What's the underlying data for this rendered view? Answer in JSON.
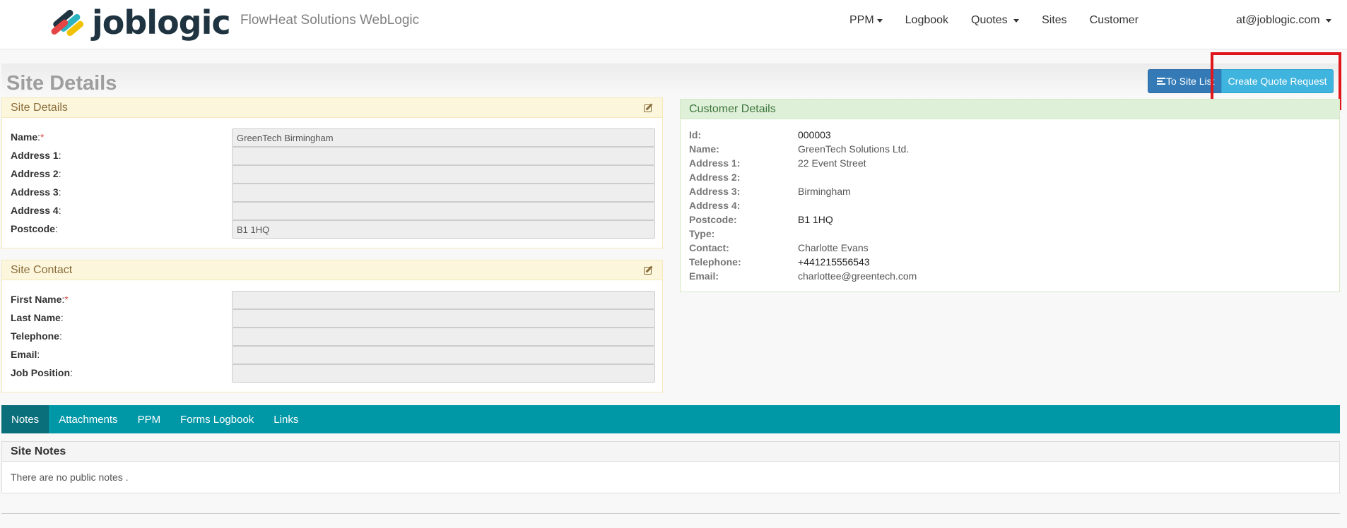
{
  "brand": {
    "logo_text": "joblogic",
    "company": "FlowHeat Solutions WebLogic"
  },
  "nav": {
    "ppm": "PPM",
    "logbook": "Logbook",
    "quotes": "Quotes",
    "sites": "Sites",
    "customer": "Customer",
    "user": "at@joblogic.com"
  },
  "page": {
    "title": "Site Details",
    "to_site_list": "To Site List",
    "create_quote": "Create Quote Request"
  },
  "site_details": {
    "heading": "Site Details",
    "fields": [
      {
        "label": "Name",
        "required": true,
        "value": "GreenTech Birmingham"
      },
      {
        "label": "Address 1",
        "required": false,
        "value": ""
      },
      {
        "label": "Address 2",
        "required": false,
        "value": ""
      },
      {
        "label": "Address 3",
        "required": false,
        "value": ""
      },
      {
        "label": "Address 4",
        "required": false,
        "value": ""
      },
      {
        "label": "Postcode",
        "required": false,
        "value": "B1 1HQ"
      }
    ]
  },
  "site_contact": {
    "heading": "Site Contact",
    "fields": [
      {
        "label": "First Name",
        "required": true,
        "value": ""
      },
      {
        "label": "Last Name",
        "required": false,
        "value": ""
      },
      {
        "label": "Telephone",
        "required": false,
        "value": ""
      },
      {
        "label": "Email",
        "required": false,
        "value": ""
      },
      {
        "label": "Job Position",
        "required": false,
        "value": ""
      }
    ]
  },
  "customer_details": {
    "heading": "Customer Details",
    "rows": [
      {
        "label": "Id:",
        "value": "000003"
      },
      {
        "label": "Name:",
        "value": "GreenTech Solutions Ltd."
      },
      {
        "label": "Address 1:",
        "value": "22 Event Street"
      },
      {
        "label": "Address 2:",
        "value": ""
      },
      {
        "label": "Address 3:",
        "value": "Birmingham"
      },
      {
        "label": "Address 4:",
        "value": ""
      },
      {
        "label": "Postcode:",
        "value": "B1 1HQ"
      },
      {
        "label": "Type:",
        "value": ""
      },
      {
        "label": "Contact:",
        "value": "Charlotte Evans"
      },
      {
        "label": "Telephone:",
        "value": "+441215556543"
      },
      {
        "label": "Email:",
        "value": "charlottee@greentech.com"
      }
    ]
  },
  "tabs": [
    "Notes",
    "Attachments",
    "PPM",
    "Forms Logbook",
    "Links"
  ],
  "notes": {
    "heading": "Site Notes",
    "empty_text": "There are no public notes ."
  },
  "colors": {
    "tab_bar": "#0097a7",
    "tab_active": "#0a6e7b",
    "primary_button": "#337ab7",
    "info_button": "#3fb4de",
    "highlight": "#e0161b"
  }
}
